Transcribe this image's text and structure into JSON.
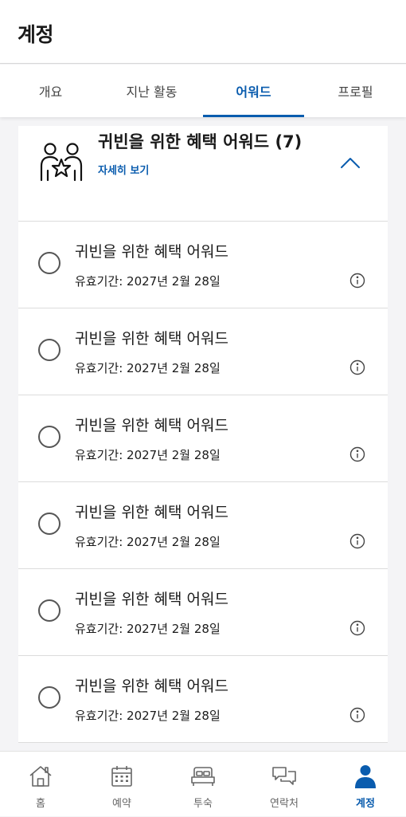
{
  "header": {
    "title": "계정"
  },
  "tabs": [
    {
      "label": "개요"
    },
    {
      "label": "지난 활동"
    },
    {
      "label": "어워드"
    },
    {
      "label": "프로필"
    }
  ],
  "award_group": {
    "title": "귀빈을 위한 혜택 어워드 (7)",
    "details_link": "자세히 보기"
  },
  "awards": [
    {
      "name": "귀빈을 위한 혜택 어워드",
      "expiry": "유효기간: 2027년 2월 28일"
    },
    {
      "name": "귀빈을 위한 혜택 어워드",
      "expiry": "유효기간: 2027년 2월 28일"
    },
    {
      "name": "귀빈을 위한 혜택 어워드",
      "expiry": "유효기간: 2027년 2월 28일"
    },
    {
      "name": "귀빈을 위한 혜택 어워드",
      "expiry": "유효기간: 2027년 2월 28일"
    },
    {
      "name": "귀빈을 위한 혜택 어워드",
      "expiry": "유효기간: 2027년 2월 28일"
    },
    {
      "name": "귀빈을 위한 혜택 어워드",
      "expiry": "유효기간: 2027년 2월 28일"
    }
  ],
  "bottom_nav": [
    {
      "label": "홈",
      "icon": "home-icon"
    },
    {
      "label": "예약",
      "icon": "calendar-icon"
    },
    {
      "label": "투숙",
      "icon": "bed-icon"
    },
    {
      "label": "연락처",
      "icon": "chat-icon"
    },
    {
      "label": "계정",
      "icon": "person-icon"
    }
  ],
  "colors": {
    "accent": "#0a5cae",
    "text": "#1a1a1a",
    "muted": "#666666",
    "background": "#f4f4f6"
  }
}
